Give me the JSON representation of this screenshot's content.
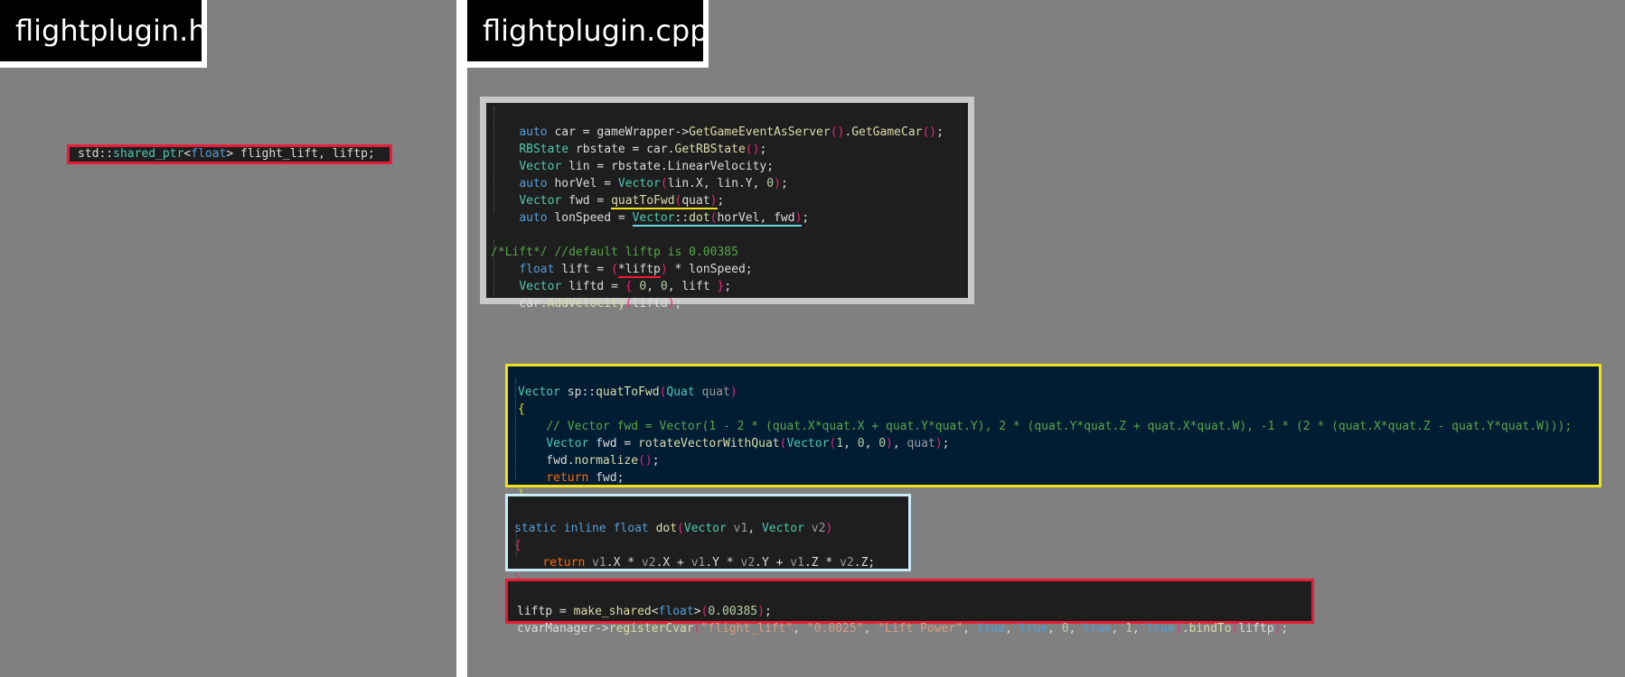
{
  "tabs": {
    "header_file": "flightplugin.h",
    "source_file": "flightplugin.cpp"
  },
  "colors": {
    "background": "#808080",
    "tab_bg": "#000000",
    "box_red": "#e81c38",
    "box_yellow": "#f0e01c",
    "box_cyan": "#c8ecf8",
    "box_gray": "#c8c8c8"
  },
  "header_code": {
    "line": "std::shared_ptr<float> flight_lift, liftp;"
  },
  "main_snippet": {
    "lines": [
      "auto car = gameWrapper->GetGameEventAsServer().GetGameCar();",
      "RBState rbstate = car.GetRBState();",
      "Vector lin = rbstate.LinearVelocity;",
      "auto horVel = Vector(lin.X, lin.Y, 0);",
      "Vector fwd = quatToFwd(quat);",
      "auto lonSpeed = Vector::dot(horVel, fwd);",
      "",
      "/*Lift*/ //default liftp is 0.00385",
      "float lift = (*liftp) * lonSpeed;",
      "Vector liftd = { 0, 0, lift };",
      "car.AddVelocity(liftd);"
    ]
  },
  "quat_snippet": {
    "lines": [
      "Vector sp::quatToFwd(Quat quat)",
      "{",
      "// Vector fwd = Vector(1 - 2 * (quat.X*quat.X + quat.Y*quat.Y), 2 * (quat.Y*quat.Z + quat.X*quat.W), -1 * (2 * (quat.X*quat.Z - quat.Y*quat.W)));",
      "Vector fwd = rotateVectorWithQuat(Vector(1, 0, 0), quat);",
      "fwd.normalize();",
      "return fwd;",
      "}"
    ]
  },
  "dot_snippet": {
    "lines": [
      "static inline float dot(Vector v1, Vector v2)",
      "{",
      "return v1.X * v2.X + v1.Y * v2.Y + v1.Z * v2.Z;",
      "}"
    ]
  },
  "cvar_snippet": {
    "lines": [
      "liftp = make_shared<float>(0.00385);",
      "cvarManager->registerCvar(\"flight_lift\", \"0.0025\", \"Lift Power\", true, true, 0, true, 1, true).bindTo(liftp);"
    ]
  }
}
